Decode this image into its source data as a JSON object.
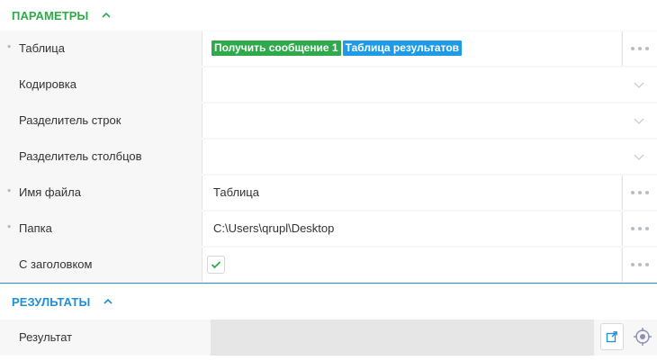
{
  "params": {
    "title": "ПАРАМЕТРЫ",
    "color": "#2eaa4a",
    "rows": {
      "table": {
        "required": "*",
        "label": "Таблица",
        "tag1": "Получить сообщение 1",
        "tag2": "Таблица результатов"
      },
      "encoding": {
        "label": "Кодировка",
        "value": ""
      },
      "row_sep": {
        "label": "Разделитель строк",
        "value": ""
      },
      "col_sep": {
        "label": "Разделитель столбцов",
        "value": ""
      },
      "filename": {
        "required": "*",
        "label": "Имя файла",
        "value": "Таблица"
      },
      "folder": {
        "required": "*",
        "label": "Папка",
        "value": "C:\\Users\\qrupl\\Desktop"
      },
      "header": {
        "label": "С заголовком",
        "checked": true
      }
    }
  },
  "results": {
    "title": "РЕЗУЛЬТАТЫ",
    "color": "#1e8fd8",
    "rows": {
      "result": {
        "label": "Результат",
        "value": ""
      }
    }
  },
  "icons": {
    "collapse": "chevron-up-icon",
    "dropdown": "chevron-down-icon",
    "more": "more-dots-icon",
    "check": "check-icon",
    "export": "export-icon",
    "target": "target-icon"
  }
}
